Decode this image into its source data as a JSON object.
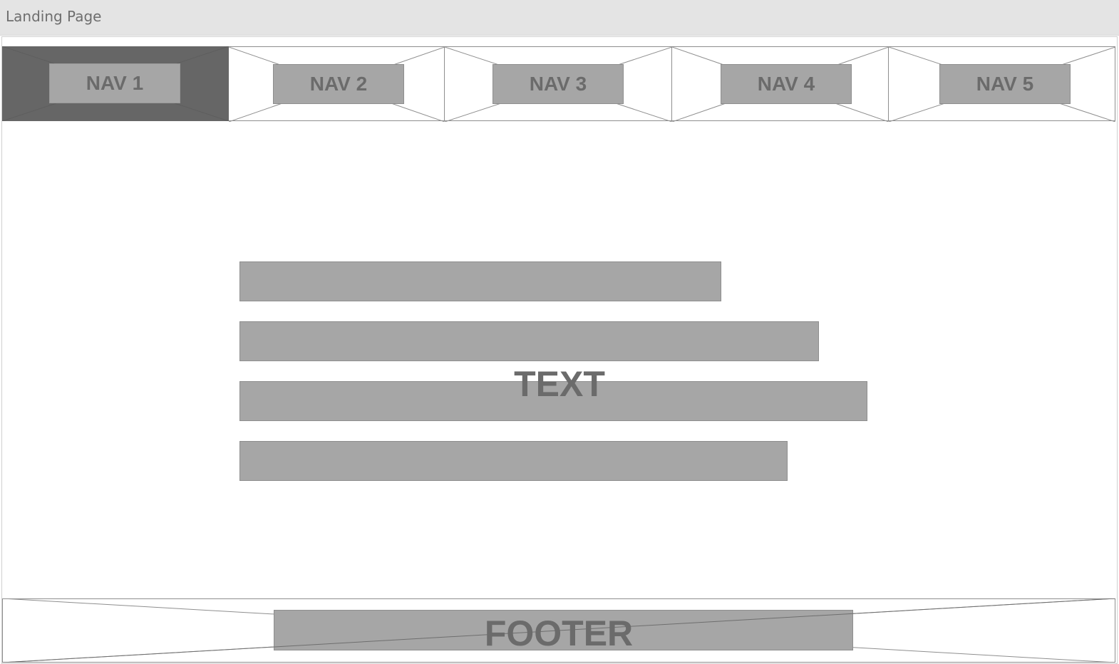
{
  "window": {
    "title": "Landing Page"
  },
  "nav": {
    "items": [
      {
        "label": "NAV 1",
        "active": true
      },
      {
        "label": "NAV 2",
        "active": false
      },
      {
        "label": "NAV 3",
        "active": false
      },
      {
        "label": "NAV 4",
        "active": false
      },
      {
        "label": "NAV 5",
        "active": false
      }
    ]
  },
  "content": {
    "label": "TEXT"
  },
  "footer": {
    "label": "FOOTER"
  },
  "colors": {
    "placeholder_fill": "#a6a6a6",
    "active_nav_bg": "#666666",
    "label_text": "#6b6b6b",
    "title_bar_bg": "#e4e4e4"
  }
}
